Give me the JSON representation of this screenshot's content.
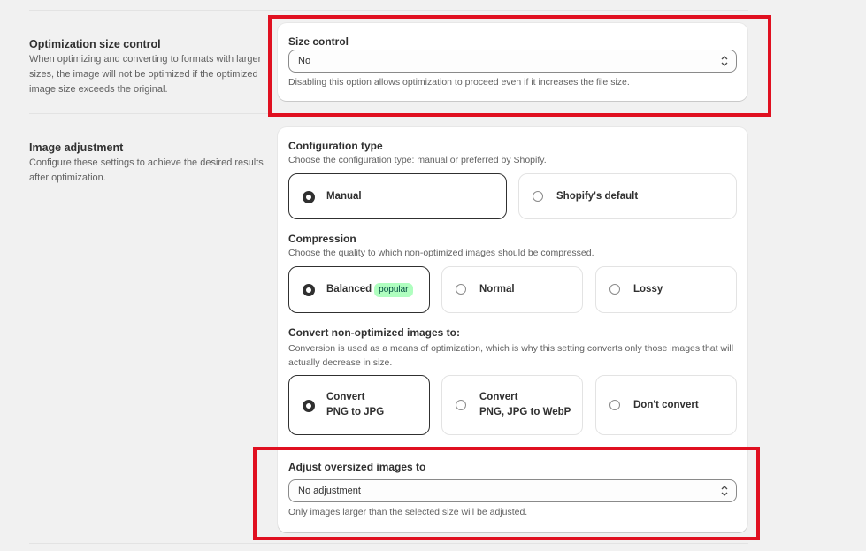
{
  "size_section": {
    "title": "Optimization size control",
    "desc": "When optimizing and converting to formats with larger sizes, the image will not be optimized if the optimized image size exceeds the original.",
    "card": {
      "label": "Size control",
      "value": "No",
      "help": "Disabling this option allows optimization to proceed even if it increases the file size."
    }
  },
  "adjust_section": {
    "title": "Image adjustment",
    "desc": "Configure these settings to achieve the desired results after optimization.",
    "config": {
      "label": "Configuration type",
      "help": "Choose the configuration type: manual or preferred by Shopify.",
      "options": [
        {
          "label": "Manual",
          "selected": true
        },
        {
          "label": "Shopify's default",
          "selected": false
        }
      ]
    },
    "compression": {
      "label": "Compression",
      "help": "Choose the quality to which non-optimized images should be compressed.",
      "options": [
        {
          "label": "Balanced",
          "badge": "popular",
          "selected": true
        },
        {
          "label": "Normal",
          "selected": false
        },
        {
          "label": "Lossy",
          "selected": false
        }
      ]
    },
    "convert": {
      "label": "Convert non-optimized images to:",
      "help": "Conversion is used as a means of optimization, which is why this setting converts only those images that will actually decrease in size.",
      "options": [
        {
          "line1": "Convert",
          "line2": "PNG to JPG",
          "selected": true
        },
        {
          "line1": "Convert",
          "line2": "PNG, JPG to WebP",
          "selected": false
        },
        {
          "line1": "Don't convert",
          "selected": false
        }
      ]
    },
    "oversize": {
      "label": "Adjust oversized images to",
      "value": "No adjustment",
      "help": "Only images larger than the selected size will be adjusted."
    }
  },
  "colors": {
    "highlight": "#e01020",
    "badge_bg": "#affebf",
    "selected_border": "#303030"
  }
}
